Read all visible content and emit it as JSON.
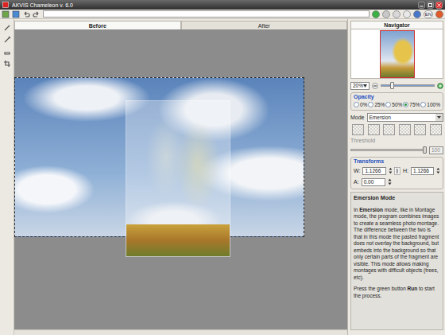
{
  "window": {
    "title": "AKVIS Chameleon v. 6.0"
  },
  "toolbar": {
    "path": "",
    "language": "EN"
  },
  "tabs": [
    {
      "label": "Before",
      "selected": true
    },
    {
      "label": "After",
      "selected": false
    }
  ],
  "navigator": {
    "title": "Navigator",
    "zoom": "20%",
    "zoom_level": 0.2
  },
  "opacity": {
    "title": "Opacity",
    "options": [
      {
        "label": "0%",
        "selected": false
      },
      {
        "label": "25%",
        "selected": false
      },
      {
        "label": "50%",
        "selected": false
      },
      {
        "label": "75%",
        "selected": true
      },
      {
        "label": "100%",
        "selected": false
      }
    ]
  },
  "mode": {
    "label": "Mode",
    "value": "Emersion",
    "buttons": [
      {
        "selected": false
      },
      {
        "selected": false
      },
      {
        "selected": false
      },
      {
        "selected": false
      },
      {
        "selected": false
      },
      {
        "selected": false
      }
    ]
  },
  "threshold": {
    "label": "Threshold",
    "value": "100",
    "level": 1,
    "disabled": true
  },
  "transforms": {
    "title": "Transforms",
    "fields": [
      {
        "label": "W:",
        "value": "1.1266"
      },
      {
        "label": "H:",
        "value": "1.1266"
      },
      {
        "label": "A:",
        "value": "0.00"
      }
    ]
  },
  "help": {
    "title": "Emersion Mode",
    "paragraphs": [
      [
        {
          "text": "In ",
          "bold": false
        },
        {
          "text": "Emersion",
          "bold": true
        },
        {
          "text": " mode, like in Montage mode, the program combines images to create a seamless photo montage. The difference between the two is that in this mode the pasted fragment does not overlay the background, but embeds into the background so that only certain parts of the fragment are visible. This mode allows making montages with difficult objects (trees, etc).",
          "bold": false
        }
      ],
      [
        {
          "text": "Press the green button ",
          "bold": false
        },
        {
          "text": "Run",
          "bold": true
        },
        {
          "text": " to start the process.",
          "bold": false
        }
      ]
    ]
  }
}
